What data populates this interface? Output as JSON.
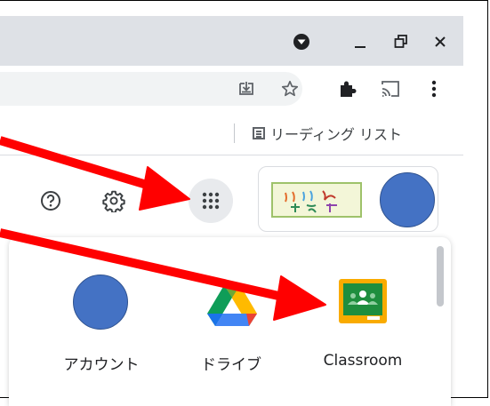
{
  "bookmarks": {
    "reading_list_label": "リーディング リスト"
  },
  "apps": [
    {
      "label": "アカウント"
    },
    {
      "label": "ドライブ"
    },
    {
      "label": "Classroom"
    }
  ],
  "colors": {
    "titlebar": "#dee1e6",
    "avatar": "#4472c4",
    "annotation_arrow": "#ff0000",
    "classroom_green": "#1e8e3e",
    "classroom_yellow": "#f9ab00"
  }
}
